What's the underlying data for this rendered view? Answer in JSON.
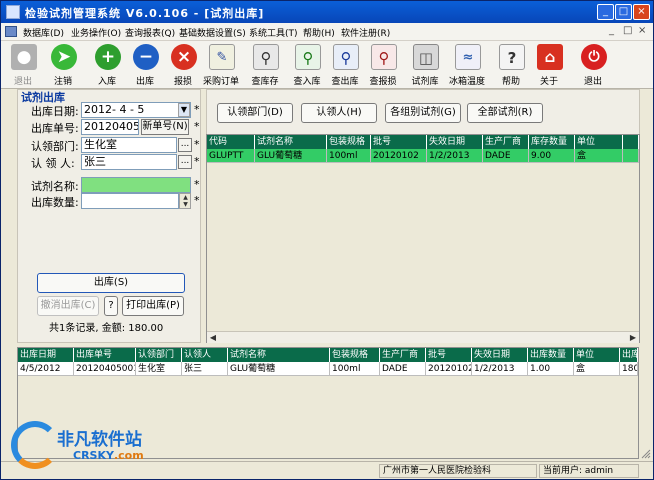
{
  "window": {
    "title": "检验试剂管理系统  V6.0.106  -  [试剂出库]",
    "controls": [
      "_",
      "□",
      "×"
    ]
  },
  "menu": {
    "items": [
      "数据库(D)",
      "业务操作(O)",
      "查询报表(Q)",
      "基础数据设置(S)",
      "系统工具(T)",
      "帮助(H)",
      "软件注册(R)"
    ],
    "mdi_controls": [
      "_",
      "□",
      "×"
    ]
  },
  "toolbar": {
    "buttons": [
      {
        "label": "退出",
        "icon": "user-icon",
        "disabled": true
      },
      {
        "label": "注销",
        "icon": "run-icon"
      },
      {
        "label": "入库",
        "icon": "plus-icon",
        "color": "#2e9e2e"
      },
      {
        "label": "出库",
        "icon": "minus-icon",
        "color": "#1f5fc4"
      },
      {
        "label": "报损",
        "icon": "x-icon",
        "color": "#d83020"
      },
      {
        "label": "采购订单",
        "icon": "order-icon"
      },
      {
        "label": "查库存",
        "icon": "magnifier-icon"
      },
      {
        "label": "查入库",
        "icon": "magnifier-in-icon"
      },
      {
        "label": "查出库",
        "icon": "magnifier-out-icon"
      },
      {
        "label": "查报损",
        "icon": "magnifier-loss-icon"
      },
      {
        "label": "试剂库",
        "icon": "database-icon"
      },
      {
        "label": "冰箱温度",
        "icon": "chart-icon"
      },
      {
        "label": "帮助",
        "icon": "help-icon"
      },
      {
        "label": "关于",
        "icon": "home-icon"
      },
      {
        "label": "退出",
        "icon": "power-icon",
        "color": "#d82020"
      }
    ]
  },
  "form": {
    "panel_title": "试剂出库",
    "date_label": "出库日期:",
    "date_value": "2012- 4 - 5",
    "order_label": "出库单号:",
    "order_value": "20120405001",
    "new_order_btn": "新单号(N)",
    "dept_label": "认领部门:",
    "dept_value": "生化室",
    "person_label": "认 领 人:",
    "person_value": "张三",
    "name_label": "试剂名称:",
    "name_value": "",
    "qty_label": "出库数量:",
    "qty_value": "",
    "star": "*",
    "dots": "...",
    "issue_btn": "出库(S)",
    "cancel_btn": "撤消出库(C)",
    "help_btn": "?",
    "print_btn": "打印出库(P)",
    "summary": "共1条记录, 金额: 180.00"
  },
  "filters": {
    "dept": "认领部门(D)",
    "person": "认领人(H)",
    "group": "各组别试剂(G)",
    "all": "全部试剂(R)"
  },
  "stock_table": {
    "headers": [
      "代码",
      "试剂名称",
      "包装规格",
      "批号",
      "失效日期",
      "生产厂商",
      "库存数量",
      "单位"
    ],
    "rows": [
      [
        "GLUPTT",
        "GLU葡萄糖",
        "100ml",
        "20120102",
        "1/2/2013",
        "DADE",
        "9.00",
        "盒"
      ]
    ]
  },
  "out_table": {
    "headers": [
      "出库日期",
      "出库单号",
      "认领部门",
      "认领人",
      "试剂名称",
      "包装规格",
      "生产厂商",
      "批号",
      "失效日期",
      "出库数量",
      "单位",
      "出库"
    ],
    "rows": [
      [
        "4/5/2012",
        "20120405001",
        "生化室",
        "张三",
        "GLU葡萄糖",
        "100ml",
        "DADE",
        "20120102",
        "1/2/2013",
        "1.00",
        "盒",
        "180"
      ]
    ]
  },
  "statusbar": {
    "org": "广州市第一人民医院检验科",
    "user": "当前用户: admin"
  },
  "watermark": {
    "cn": "非凡软件站",
    "en_a": "CRSKY",
    "en_b": ".com"
  }
}
